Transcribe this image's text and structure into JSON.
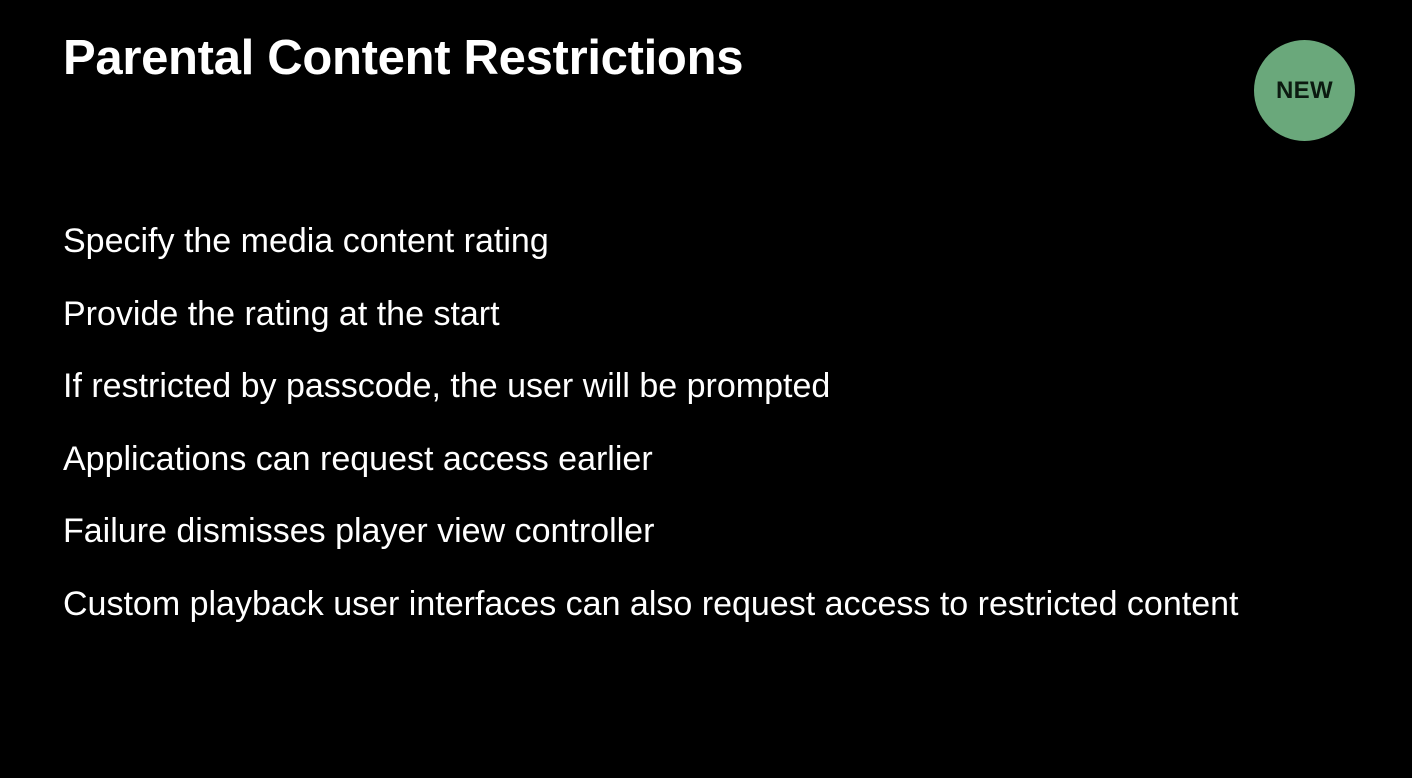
{
  "title": "Parental Content Restrictions",
  "badge": {
    "label": "NEW",
    "color": "#6aa87b"
  },
  "bullets": [
    "Specify the media content rating",
    "Provide the rating at the start",
    "If restricted by passcode, the user will be prompted",
    "Applications can request access earlier",
    "Failure dismisses player view controller",
    "Custom playback user interfaces can also request access to restricted content"
  ]
}
